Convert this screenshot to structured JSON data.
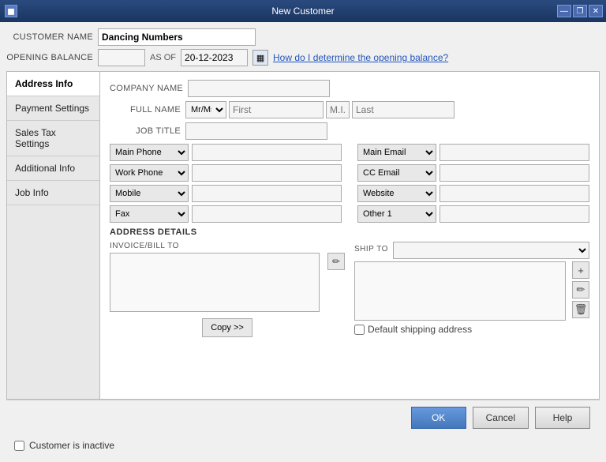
{
  "titlebar": {
    "title": "New Customer",
    "icon": "◼",
    "btn_minimize": "—",
    "btn_restore": "❐",
    "btn_close": "✕"
  },
  "top_form": {
    "customer_name_label": "CUSTOMER NAME",
    "customer_name_value": "Dancing Numbers",
    "opening_balance_label": "OPENING BALANCE",
    "opening_balance_value": "",
    "as_of_label": "AS OF",
    "as_of_date": "20-12-2023",
    "help_link": "How do I determine the opening balance?"
  },
  "sidebar": {
    "items": [
      {
        "id": "address-info",
        "label": "Address Info",
        "active": true
      },
      {
        "id": "payment-settings",
        "label": "Payment Settings",
        "active": false
      },
      {
        "id": "sales-tax-settings",
        "label": "Sales Tax Settings",
        "active": false
      },
      {
        "id": "additional-info",
        "label": "Additional Info",
        "active": false
      },
      {
        "id": "job-info",
        "label": "Job Info",
        "active": false
      }
    ]
  },
  "main": {
    "company_name_label": "COMPANY NAME",
    "company_name_value": "",
    "full_name_label": "FULL NAME",
    "mr_ms_placeholder": "Mr/Ms./.",
    "first_placeholder": "First",
    "mi_placeholder": "M.I.",
    "last_placeholder": "Last",
    "job_title_label": "JOB TITLE",
    "job_title_value": "",
    "phone_fields": [
      {
        "type": "Main Phone",
        "value": ""
      },
      {
        "type": "Work Phone",
        "value": ""
      },
      {
        "type": "Mobile",
        "value": ""
      },
      {
        "type": "Fax",
        "value": ""
      }
    ],
    "email_fields": [
      {
        "type": "Main Email",
        "value": ""
      },
      {
        "type": "CC Email",
        "value": ""
      },
      {
        "type": "Website",
        "value": ""
      },
      {
        "type": "Other 1",
        "value": ""
      }
    ],
    "address_section_title": "ADDRESS DETAILS",
    "invoice_bill_to_label": "INVOICE/BILL TO",
    "invoice_bill_to_value": "",
    "ship_to_label": "SHIP TO",
    "ship_to_options": [
      ""
    ],
    "copy_btn_label": "Copy >>",
    "default_shipping_label": "Default shipping address",
    "edit_icon": "✏",
    "add_icon": "+",
    "pencil_icon": "✏",
    "delete_icon": "🗑"
  },
  "footer_buttons": {
    "ok_label": "OK",
    "cancel_label": "Cancel",
    "help_label": "Help"
  },
  "bottom": {
    "inactive_checkbox_label": "Customer is inactive"
  }
}
